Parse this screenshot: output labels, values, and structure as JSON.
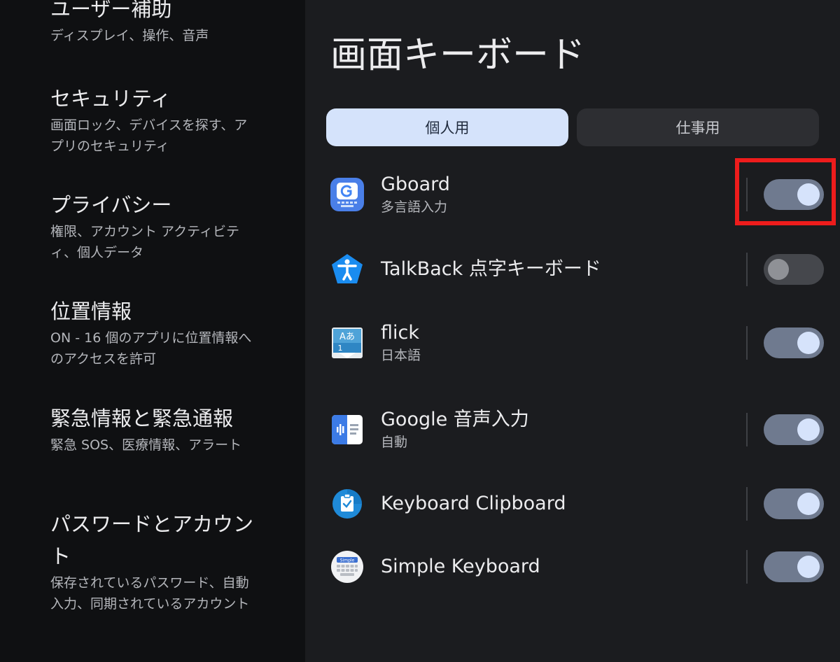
{
  "sidebar": {
    "items": [
      {
        "title": "ユーザー補助",
        "subtitle": "ディスプレイ、操作、音声"
      },
      {
        "title": "セキュリティ",
        "subtitle": "画面ロック、デバイスを探す、アプリのセキュリティ"
      },
      {
        "title": "プライバシー",
        "subtitle": "権限、アカウント アクティビティ、個人データ"
      },
      {
        "title": "位置情報",
        "subtitle": "ON - 16 個のアプリに位置情報へのアクセスを許可"
      },
      {
        "title": "緊急情報と緊急通報",
        "subtitle": "緊急 SOS、医療情報、アラート"
      },
      {
        "title": "パスワードとアカウント",
        "subtitle": "保存されているパスワード、自動入力、同期されているアカウント"
      }
    ]
  },
  "main": {
    "title": "画面キーボード",
    "tabs": [
      {
        "label": "個人用",
        "selected": true
      },
      {
        "label": "仕事用",
        "selected": false
      }
    ],
    "keyboards": [
      {
        "name": "Gboard",
        "subtitle": "多言語入力",
        "enabled": true,
        "icon": "gboard-icon"
      },
      {
        "name": "TalkBack 点字キーボード",
        "subtitle": "",
        "enabled": false,
        "icon": "talkback-icon"
      },
      {
        "name": "flick",
        "subtitle": "日本語",
        "enabled": true,
        "icon": "flick-icon"
      },
      {
        "name": "Google 音声入力",
        "subtitle": "自動",
        "enabled": true,
        "icon": "google-voice-icon"
      },
      {
        "name": "Keyboard Clipboard",
        "subtitle": "",
        "enabled": true,
        "icon": "clipboard-icon"
      },
      {
        "name": "Simple Keyboard",
        "subtitle": "",
        "enabled": true,
        "icon": "simple-keyboard-icon"
      }
    ],
    "icon_labels": {
      "flick_top": "Aあ",
      "flick_bottom": "1",
      "simple_badge": "Simple"
    }
  },
  "colors": {
    "sidebar_bg": "#0f1012",
    "main_bg": "#1b1c1f",
    "tab_selected": "#d5e3fb",
    "switch_on_track": "#6f7a8f",
    "switch_on_thumb": "#d6e3fb",
    "highlight": "#ee1c1c"
  }
}
